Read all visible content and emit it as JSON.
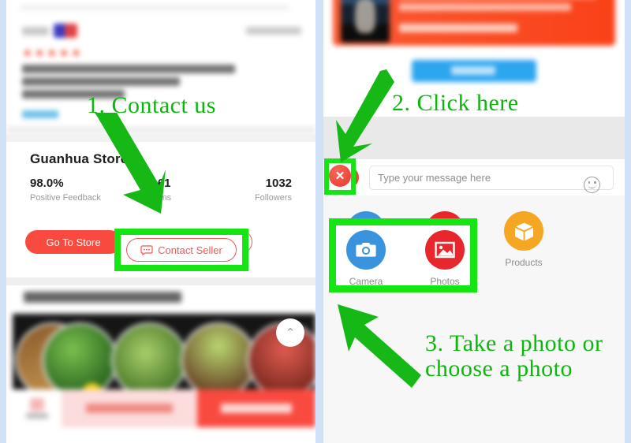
{
  "colors": {
    "annotation_green": "#0ab80a",
    "highlight_green": "#15e512",
    "brand_red": "#f94a40",
    "contact_red": "#f05a52",
    "camera_blue": "#3a94dd",
    "photos_red": "#e8262c",
    "products_orange": "#f5a623",
    "page_background": "#cfe0f7",
    "chat_background": "#e9e9e9"
  },
  "left_panel": {
    "review": {
      "stars": "★★★★★",
      "blurred": true
    },
    "store": {
      "name": "Guanhua Store",
      "stats": [
        {
          "value": "98.0%",
          "label": "Positive Feedback"
        },
        {
          "value": "161",
          "label": "items"
        },
        {
          "value": "1032",
          "label": "Followers"
        }
      ],
      "go_to_store_label": "Go To Store",
      "contact_seller_label": "Contact Seller"
    },
    "recommendations": {
      "title_blurred": "Seller Recommendations",
      "scroll_top_icon": "⌃",
      "bottom_bar": {
        "store_label_blurred": "store",
        "add_to_cart_label_blurred": "ADD TO CART",
        "buy_now_label_blurred": "BUY NOW"
      }
    }
  },
  "right_panel": {
    "product_card": {
      "title_blurred": "Photo Frame Love Screen DIY",
      "price_blurred": "US $14.88 - 16.88",
      "send_button_label_blurred": "Send"
    },
    "message_bar": {
      "close_icon": "✕",
      "input_placeholder": "Type your message here",
      "emoji_icon": "smiley-icon"
    },
    "attachments": [
      {
        "label": "Camera",
        "icon": "camera-icon",
        "color": "#3a94dd"
      },
      {
        "label": "Photos",
        "icon": "photo-icon",
        "color": "#e8262c"
      },
      {
        "label": "Products",
        "icon": "box-icon",
        "color": "#f5a623"
      }
    ]
  },
  "annotations": {
    "step1": "1. Contact us",
    "step2": "2. Click here",
    "step3_line1": "3. Take a photo or",
    "step3_line2": "choose a photo"
  }
}
